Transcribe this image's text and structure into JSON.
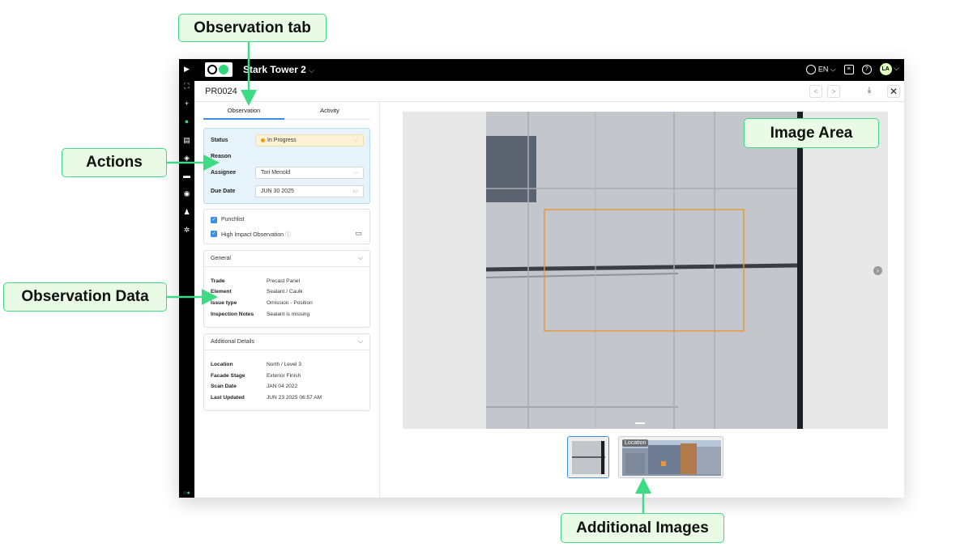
{
  "project": {
    "name": "Stark Tower 2"
  },
  "topbar": {
    "language": "EN",
    "avatar_initials": "LA"
  },
  "record": {
    "id": "PR0024"
  },
  "tabs": [
    "Observation",
    "Activity"
  ],
  "actions": {
    "status_label": "Status",
    "status_value": "In Progress",
    "reason_label": "Reason",
    "assignee_label": "Assignee",
    "assignee_value": "Tori Menold",
    "due_label": "Due Date",
    "due_value": "JUN 30 2025"
  },
  "flags": {
    "punchlist": "Punchlist",
    "high_impact": "High Impact Observation"
  },
  "general": {
    "title": "General",
    "rows": [
      {
        "k": "Trade",
        "v": "Precast Panel"
      },
      {
        "k": "Element",
        "v": "Sealant / Caulk"
      },
      {
        "k": "Issue type",
        "v": "Omission - Position"
      },
      {
        "k": "Inspection Notes",
        "v": "Sealant is missing"
      }
    ]
  },
  "details": {
    "title": "Additional Details",
    "rows": [
      {
        "k": "Location",
        "v": "North / Level 3"
      },
      {
        "k": "Facade Stage",
        "v": "Exterior Finish"
      },
      {
        "k": "Scan Date",
        "v": "JAN 04 2022"
      },
      {
        "k": "Last Updated",
        "v": "JUN 23 2025 06:57 AM"
      }
    ]
  },
  "thumbnails": {
    "location_label": "Location"
  },
  "callouts": {
    "observation_tab": "Observation tab",
    "actions": "Actions",
    "observation_data": "Observation Data",
    "image_area": "Image Area",
    "additional_images": "Additional Images"
  },
  "colors": {
    "accent": "#3ddc84",
    "callout_bg": "#e9fbe4",
    "selection": "#3a8ee6",
    "status": "#f39c12",
    "highlight_box": "#e8963a"
  }
}
